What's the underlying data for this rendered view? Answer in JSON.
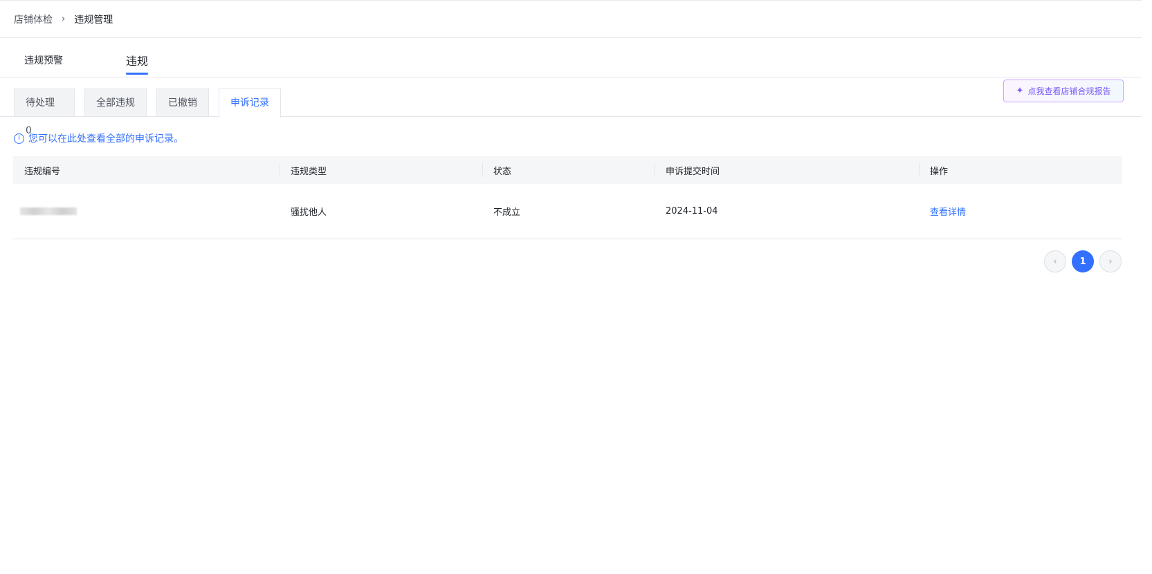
{
  "breadcrumb": {
    "parent": "店铺体检",
    "current": "违规管理"
  },
  "main_tabs": [
    {
      "label": "违规预警"
    },
    {
      "label": "违规"
    }
  ],
  "sub_tabs": [
    {
      "label": "待处理 0"
    },
    {
      "label": "全部违规"
    },
    {
      "label": "已撤销"
    },
    {
      "label": "申诉记录"
    }
  ],
  "report_button": {
    "label": "点我查看店铺合规报告"
  },
  "hint": {
    "text": "您可以在此处查看全部的申诉记录。"
  },
  "table": {
    "headers": [
      "违规编号",
      "违规类型",
      "状态",
      "申诉提交时间",
      "操作"
    ],
    "rows": [
      {
        "type": "骚扰他人",
        "status": "不成立",
        "time": "2024-11-04",
        "action": "查看详情"
      }
    ]
  },
  "pagination": {
    "current": "1",
    "prev": "‹",
    "next": "›"
  },
  "colors": {
    "accent": "#3370ff",
    "report_accent": "#7a5af8"
  }
}
